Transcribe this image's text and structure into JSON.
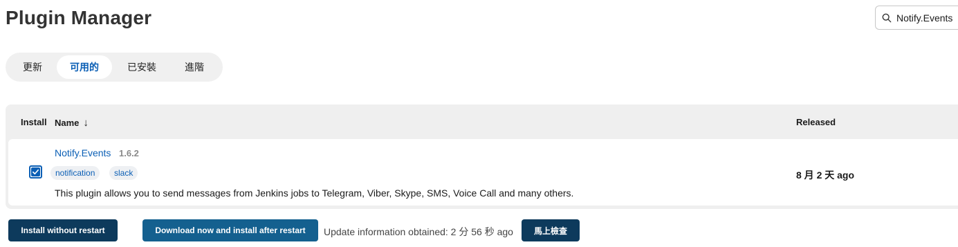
{
  "page": {
    "title": "Plugin Manager"
  },
  "search": {
    "value": "Notify.Events",
    "icon": "search-icon"
  },
  "tabs": [
    {
      "label": "更新"
    },
    {
      "label": "可用的",
      "active": true
    },
    {
      "label": "已安裝"
    },
    {
      "label": "進階"
    }
  ],
  "table": {
    "headers": {
      "install": "Install",
      "name": "Name",
      "sort_indicator": "↓",
      "released": "Released"
    },
    "rows": [
      {
        "checked": true,
        "name": "Notify.Events",
        "version": "1.6.2",
        "tags": [
          "notification",
          "slack"
        ],
        "description": "This plugin allows you to send messages from Jenkins jobs to Telegram, Viber, Skype, SMS, Voice Call and many others.",
        "released": "8 月 2 天 ago"
      }
    ]
  },
  "footer": {
    "install_without_restart": "Install without restart",
    "download_install_after_restart": "Download now and install after restart",
    "update_info": "Update information obtained: 2 分 56 秒 ago",
    "check_now": "馬上檢查"
  },
  "colors": {
    "accent": "#0b5fb5",
    "primary_button": "#0d3a5c",
    "secondary_button": "#14608f"
  }
}
